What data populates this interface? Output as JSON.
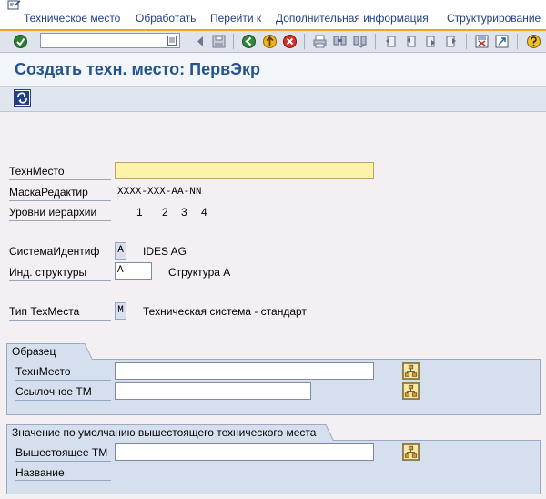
{
  "menu": {
    "items": [
      "Техническое место",
      "Обработать",
      "Перейти к",
      "Дополнительная информация",
      "Структурирование"
    ]
  },
  "toolbar": {
    "command_value": "",
    "icons": [
      "enter-icon",
      "save-icon",
      "back-icon",
      "exit-icon",
      "cancel-icon",
      "print-icon",
      "find-icon",
      "find-next-icon",
      "first-page-icon",
      "prev-page-icon",
      "next-page-icon",
      "last-page-icon",
      "create-session-icon",
      "shortcut-icon",
      "help-icon"
    ]
  },
  "title": "Создать техн. место: ПервЭкр",
  "form": {
    "techmesto_label": "ТехнМесто",
    "techmesto_value": "",
    "mask_label": "МаскаРедактир",
    "mask_value": "XXXX-XXX-AA-NN",
    "levels_label": "Уровни иерархии",
    "levels": [
      "1",
      "2",
      "3",
      "4"
    ],
    "sysid_label": "СистемаИдентиф",
    "sysid_value": "A",
    "sysid_desc": "IDES AG",
    "ind_label": "Инд. структуры",
    "ind_value": "A",
    "ind_desc": "Структура А",
    "type_label": "Тип ТехМеста",
    "type_value": "M",
    "type_desc": "Техническая система - стандарт"
  },
  "sample_group": {
    "title": "Образец",
    "techmesto_label": "ТехнМесто",
    "techmesto_value": "",
    "ref_label": "Ссылочное ТМ",
    "ref_value": ""
  },
  "parent_group": {
    "title": "Значение по умолчанию вышестоящего технического места",
    "parent_label": "Вышестоящее ТМ",
    "parent_value": "",
    "name_label": "Название"
  },
  "colors": {
    "menu_text": "#1f3d8a",
    "title_text": "#24528c",
    "required_field": "#fdf3a8",
    "group_bg": "#d5dfee",
    "accent_line": "#e3a62f"
  }
}
